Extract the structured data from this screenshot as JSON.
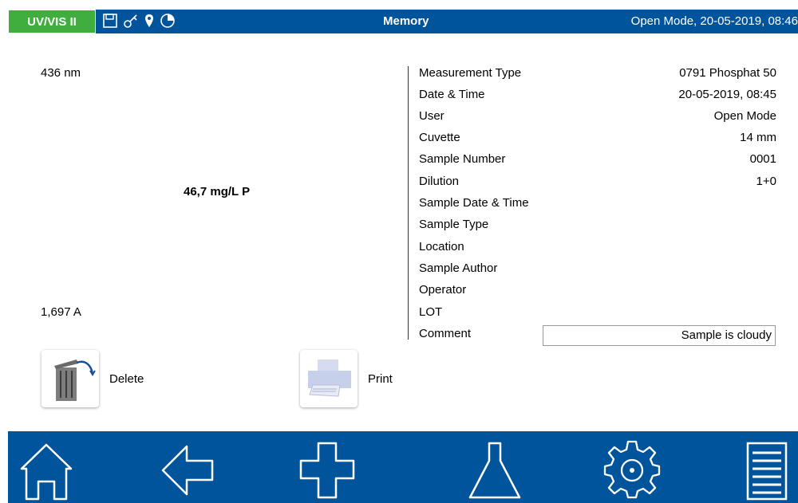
{
  "header": {
    "brand": "UV/VIS II",
    "title": "Memory",
    "mode_info": "Open Mode, 20-05-2019, 08:46",
    "status_icons": [
      "save-icon",
      "key-icon",
      "location-pin-icon",
      "pie-timer-icon"
    ]
  },
  "left_panel": {
    "wavelength": "436 nm",
    "result": "46,7 mg/L P",
    "absorbance": "1,697 A"
  },
  "details": [
    {
      "label": "Measurement Type",
      "value": "0791 Phosphat 50"
    },
    {
      "label": "Date & Time",
      "value": "20-05-2019, 08:45"
    },
    {
      "label": "User",
      "value": "Open Mode"
    },
    {
      "label": "Cuvette",
      "value": "14 mm"
    },
    {
      "label": "Sample Number",
      "value": "0001"
    },
    {
      "label": "Dilution",
      "value": "1+0"
    },
    {
      "label": "Sample Date & Time",
      "value": ""
    },
    {
      "label": "Sample Type",
      "value": ""
    },
    {
      "label": "Location",
      "value": ""
    },
    {
      "label": "Sample Author",
      "value": ""
    },
    {
      "label": "Operator",
      "value": ""
    },
    {
      "label": "LOT",
      "value": ""
    },
    {
      "label": "Comment",
      "value": "Sample is cloudy"
    }
  ],
  "actions": {
    "delete_label": "Delete",
    "print_label": "Print"
  },
  "nav": [
    "home-icon",
    "back-arrow-icon",
    "add-icon",
    "flask-icon",
    "settings-gear-icon",
    "menu-list-icon"
  ],
  "colors": {
    "bar_blue": "#00549c",
    "brand_green": "#3fae3f"
  }
}
